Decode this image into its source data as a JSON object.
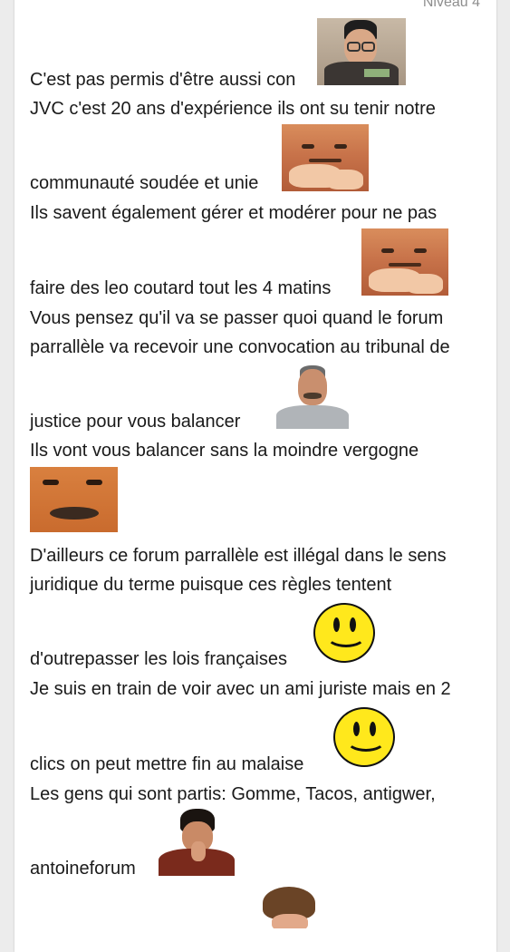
{
  "header": {
    "level_label": "Niveau 4"
  },
  "message": {
    "lines": [
      "C'est pas permis d'être aussi con",
      "JVC c'est 20 ans d'expérience ils ont su tenir notre",
      "communauté soudée et unie",
      "Ils savent également gérer et modérer pour ne pas",
      "faire des leo coutard tout les 4 matins",
      "Vous pensez qu'il va se passer quoi quand le forum",
      "parrallèle va recevoir une convocation au tribunal de",
      "justice pour vous balancer",
      "Ils vont vous balancer sans la moindre vergogne",
      "D'ailleurs ce forum parrallèle est illégal dans le sens",
      "juridique du terme puisque ces règles tentent",
      "d'outrepasser les lois françaises",
      "Je suis en train de voir avec un ami juriste mais en 2",
      "clics on peut mettre fin au malaise",
      "Les gens qui sont partis: Gomme, Tacos, antigwer,",
      "antoineforum"
    ],
    "stickers": [
      "old-man-money-sticker",
      "laughing-face-sticker",
      "laughing-face-sticker",
      "risitas-sticker",
      "risitas-zoom-sticker",
      "smiley-icon",
      "smiley-icon",
      "laughing-young-man-sticker",
      "curly-hair-sticker"
    ]
  },
  "colors": {
    "page_background": "#ececec",
    "card_background": "#ffffff",
    "text": "#1a1a1a",
    "muted": "#8e8e8e",
    "smiley_yellow": "#ffe81c"
  }
}
